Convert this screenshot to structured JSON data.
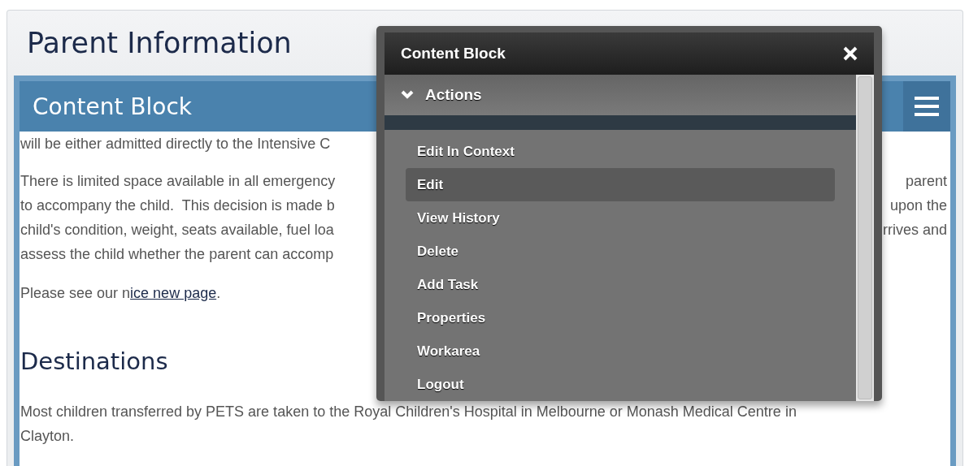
{
  "page": {
    "title": "Parent Information"
  },
  "content_block": {
    "title": "Content Block",
    "paragraphs": [
      {
        "lines": [
          {
            "left": "will be either admitted directly to the Intensive C"
          }
        ]
      },
      {
        "lines": [
          {
            "left": "There is limited space available in all emergency",
            "right": "parent"
          },
          {
            "left": "to accompany the child.  This decision is made b",
            "right": "upon the"
          },
          {
            "left": "child's condition, weight, seats available, fuel loa",
            "right": "rrives and"
          },
          {
            "left": "assess the child whether the parent can accomp"
          }
        ]
      }
    ],
    "link_line": {
      "before": "Please see our n",
      "link": "ice new page",
      "after": "."
    },
    "heading": "Destinations",
    "paragraph": [
      "Most children transferred by PETS are taken to the Royal Children's Hospital in Melbourne or Monash Medical Centre in",
      "Clayton."
    ]
  },
  "popup": {
    "title": "Content Block",
    "section": {
      "label": "Actions",
      "expanded": true
    },
    "items": [
      {
        "label": "Edit In Context",
        "selected": false
      },
      {
        "label": "Edit",
        "selected": true
      },
      {
        "label": "View History",
        "selected": false
      },
      {
        "label": "Delete",
        "selected": false
      },
      {
        "label": "Add Task",
        "selected": false
      },
      {
        "label": "Properties",
        "selected": false
      },
      {
        "label": "Workarea",
        "selected": false
      },
      {
        "label": "Logout",
        "selected": false
      }
    ]
  }
}
